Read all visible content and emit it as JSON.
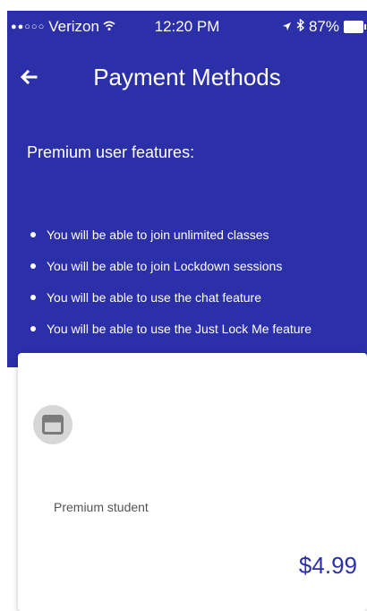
{
  "status_bar": {
    "carrier": "Verizon",
    "time": "12:20 PM",
    "battery": "87%"
  },
  "header": {
    "title": "Payment Methods",
    "features_heading": "Premium user features:",
    "features": [
      "You will be able to join unlimited classes",
      "You will be able to join Lockdown sessions",
      "You will be able to use the chat feature",
      "You will be able to use the Just Lock Me feature"
    ]
  },
  "card": {
    "icon": "credit-card-icon",
    "label": "Premium student",
    "price": "$4.99"
  },
  "colors": {
    "header_bg": "#2b2fa8",
    "price": "#2b2fa8",
    "icon_circle": "#d7d7d7"
  }
}
